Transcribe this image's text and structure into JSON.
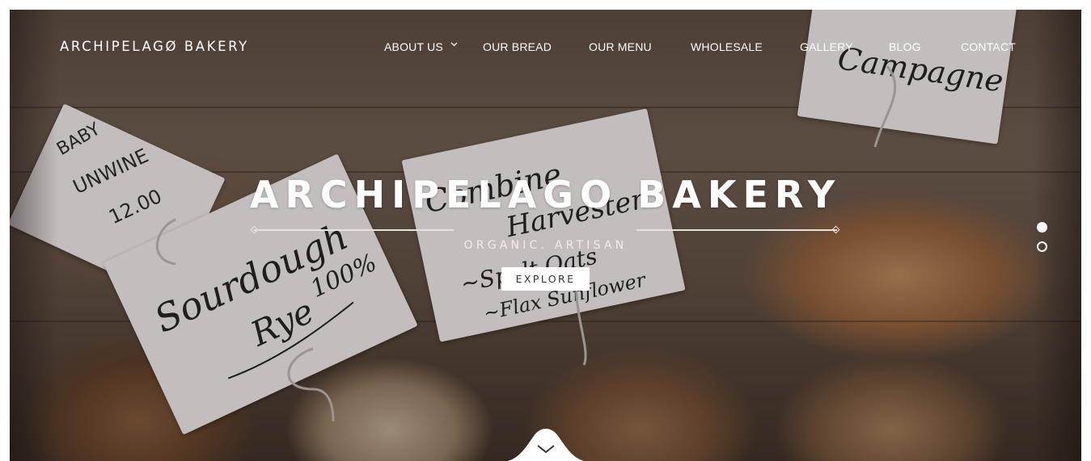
{
  "brand": {
    "logo_text": "ARCHIPELAGØ BAKERY"
  },
  "nav": {
    "items": [
      {
        "label": "ABOUT US",
        "has_dropdown": true
      },
      {
        "label": "OUR BREAD"
      },
      {
        "label": "OUR MENU"
      },
      {
        "label": "WHOLESALE"
      },
      {
        "label": "GALLERY"
      },
      {
        "label": "BLOG"
      },
      {
        "label": "CONTACT"
      }
    ]
  },
  "hero": {
    "headline": "ARCHIPELAGO BAKERY",
    "subheadline": "ORGANIC. ARTISAN",
    "cta_label": "EXPLORE",
    "slide_count": 2,
    "active_slide": 1,
    "photo_tags": [
      {
        "lines": [
          "BABY",
          "UNWINE",
          "12.00"
        ]
      },
      {
        "lines": [
          "Sourdough",
          "Rye 100%"
        ]
      },
      {
        "lines": [
          "Combine",
          "Harvester",
          "~Spelt Oats",
          "~Flax Sunflower"
        ]
      },
      {
        "lines": [
          "Campagne"
        ]
      }
    ]
  },
  "icons": {
    "dropdown": "chevron-down-icon",
    "scroll": "chevron-down-icon"
  },
  "colors": {
    "nav_text": "#ffffff",
    "headline_text": "#ffffff",
    "button_bg": "#ffffff",
    "button_text": "#333333"
  }
}
